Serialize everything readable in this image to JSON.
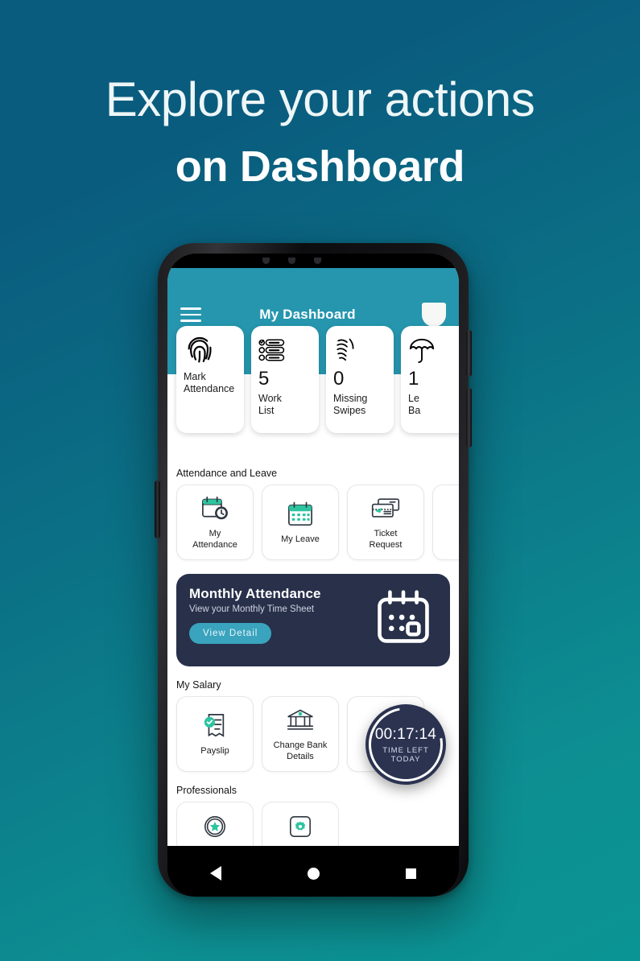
{
  "headline": {
    "line1": "Explore your actions",
    "line2": "on Dashboard"
  },
  "colors": {
    "bg_top": "#0a5c7e",
    "bg_bottom": "#0d8f92",
    "header": "#2596ae",
    "accent_teal": "#3aa3bd",
    "banner_navy": "#28304a",
    "icon_green": "#2ec4a0"
  },
  "app": {
    "header": {
      "menu_icon": "hamburger-icon",
      "title": "My Dashboard",
      "avatar": "avatar-icon"
    },
    "stat_cards": [
      {
        "icon": "fingerprint-icon",
        "number": "",
        "label": "Mark\nAttendance",
        "label_l1": "Mark",
        "label_l2": "Attendance"
      },
      {
        "icon": "checklist-icon",
        "number": "5",
        "label_l1": "Work",
        "label_l2": "List"
      },
      {
        "icon": "swipe-icon",
        "number": "0",
        "label_l1": "Missing",
        "label_l2": "Swipes"
      },
      {
        "icon": "umbrella-icon",
        "number": "1",
        "label_l1": "Le",
        "label_l2": "Ba"
      }
    ],
    "sections": [
      {
        "title": "Attendance and Leave",
        "tiles": [
          {
            "icon": "calendar-clock-icon",
            "label_l1": "My",
            "label_l2": "Attendance"
          },
          {
            "icon": "calendar-icon",
            "label_l1": "My Leave",
            "label_l2": ""
          },
          {
            "icon": "ticket-icon",
            "label_l1": "Ticket",
            "label_l2": "Request"
          },
          {
            "icon": "partial-icon",
            "label_l1": "",
            "label_l2": ""
          }
        ]
      },
      {
        "title": "My Salary",
        "tiles": [
          {
            "icon": "payslip-icon",
            "label_l1": "Payslip",
            "label_l2": ""
          },
          {
            "icon": "bank-icon",
            "label_l1": "Change Bank",
            "label_l2": "Details"
          },
          {
            "icon": "handshake-money-icon",
            "label_l1": "",
            "label_l2": ""
          }
        ]
      },
      {
        "title": "Professionals",
        "tiles": [
          {
            "icon": "star-badge-icon",
            "label_l1": "",
            "label_l2": ""
          },
          {
            "icon": "gear-icon",
            "label_l1": "",
            "label_l2": ""
          }
        ]
      }
    ],
    "banner": {
      "title": "Monthly Attendance",
      "subtitle": "View your Monthly Time Sheet",
      "button_label": "View Detail",
      "icon": "calendar-large-icon"
    },
    "timer": {
      "time": "00:17:14",
      "label_line1": "TIME LEFT",
      "label_line2": "TODAY"
    },
    "navbar": {
      "back": "back-triangle-icon",
      "home": "home-circle-icon",
      "recents": "recents-square-icon"
    }
  }
}
